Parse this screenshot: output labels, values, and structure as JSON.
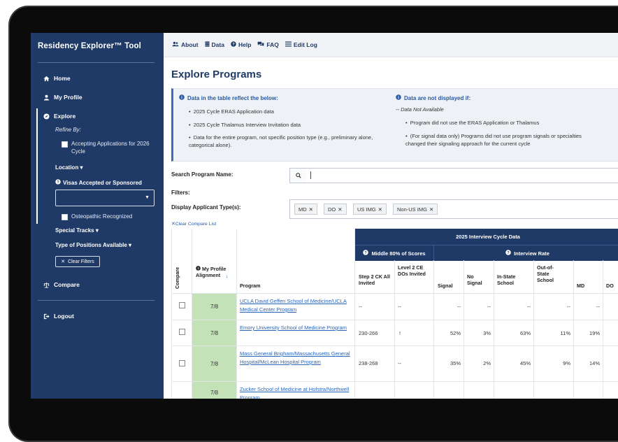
{
  "sidebar": {
    "title": "Residency Explorer™ Tool",
    "nav": {
      "home": "Home",
      "profile": "My Profile",
      "explore": "Explore",
      "compare": "Compare",
      "logout": "Logout"
    },
    "refine_by": "Refine By:",
    "accepting": "Accepting Applications for 2026 Cycle",
    "location": "Location ▾",
    "visas": "Visas Accepted or Sponsored",
    "osteopathic": "Osteopathic Recognized",
    "special_tracks": "Special Tracks ▾",
    "positions": "Type of Positions Available ▾",
    "clear_filters": "Clear Filters"
  },
  "topbar": {
    "about": "About",
    "data": "Data",
    "help": "Help",
    "faq": "FAQ",
    "edit_log": "Edit Log"
  },
  "page_title": "Explore Programs",
  "info": {
    "left_head": "Data in the table reflect the below:",
    "left_items": [
      "2025 Cycle ERAS Application data",
      "2025 Cycle Thalamus Interview Invitation data",
      "Data for the entire program, not specific position type (e.g., preliminary alone, categorical alone)."
    ],
    "right_head": "Data are not displayed if:",
    "right_sub": "-- Data Not Available",
    "right_items": [
      "Program did not use the ERAS Application or Thalamus",
      "(For signal data only) Programs did not use program signals or specialties changed their signaling approach for the current cycle"
    ]
  },
  "search": {
    "label": "Search Program Name:",
    "value": ""
  },
  "filters_label": "Filters:",
  "applicant_label": "Display Applicant Type(s):",
  "tags": [
    "MD",
    "DO",
    "US IMG",
    "Non-US IMG"
  ],
  "clear_compare": "Clear Compare List",
  "table": {
    "group_header": "2025 Interview Cycle Data",
    "middle_header": "Middle 80% of Scores",
    "rate_header": "Interview Rate",
    "col_compare": "Compare",
    "col_alignment": "My Profile Alignment",
    "col_program": "Program",
    "col_step2": "Step 2 CK All Invited",
    "col_level2": "Level 2 CE DOs Invited",
    "col_signal": "Signal",
    "col_nosignal": "No Signal",
    "col_instate": "In-State School",
    "col_outstate": "Out-of-State School",
    "col_md": "MD",
    "col_do": "DO",
    "rows": [
      {
        "alignment": "7/8",
        "program": "UCLA David Geffen School of Medicine/UCLA Medical Center Program",
        "step2": "--",
        "level2": "--",
        "signal": "--",
        "nosignal": "--",
        "instate": "--",
        "outstate": "--",
        "md": "--"
      },
      {
        "alignment": "7/8",
        "program": "Emory University School of Medicine Program",
        "step2": "230-266",
        "level2": "!",
        "signal": "52%",
        "nosignal": "3%",
        "instate": "63%",
        "outstate": "11%",
        "md": "19%"
      },
      {
        "alignment": "7/8",
        "program": "Mass General Brigham/Massachusetts General Hospital/McLean Hospital Program",
        "step2": "238-268",
        "level2": "--",
        "signal": "35%",
        "nosignal": "2%",
        "instate": "45%",
        "outstate": "9%",
        "md": "14%"
      },
      {
        "alignment": "7/8",
        "program": "Zucker School of Medicine at Hofstra/Northwell Program",
        "step2": "",
        "level2": "",
        "signal": "",
        "nosignal": "",
        "instate": "",
        "outstate": "",
        "md": ""
      }
    ]
  },
  "colors": {
    "navy": "#1f3a66",
    "alignment_green": "#c3e2b8",
    "link": "#2a66b8"
  }
}
